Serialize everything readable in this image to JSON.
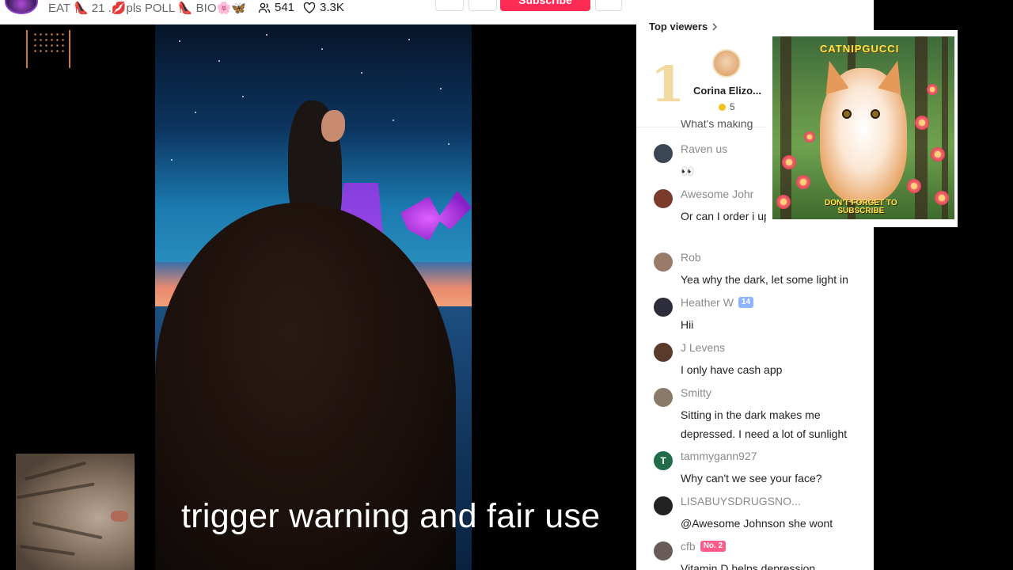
{
  "header": {
    "title": "EAT 👠 21 .💋pls POLL 👠 BIO🌸🦋",
    "viewers": "541",
    "likes": "3.3K",
    "subscribe_label": "Subscribe"
  },
  "caption": "trigger warning and fair use",
  "top_viewers": {
    "label": "Top viewers",
    "rank": "1",
    "name": "Corina Elizo...",
    "coins": "5",
    "partial_text": "What's making"
  },
  "comments": [
    {
      "name": "Raven us",
      "text": "👀",
      "badge": "",
      "avatar_color": "#3b4654"
    },
    {
      "name": "Awesome Johr",
      "text": "Or can I order i up",
      "badge": "",
      "avatar_color": "#7a3b2a"
    },
    {
      "name": "Rob",
      "text": "Yea why the dark, let some light in",
      "badge": "",
      "avatar_color": "#9a7a68"
    },
    {
      "name": "Heather W",
      "text": "Hii",
      "badge": "14",
      "avatar_color": "#2c2c3a"
    },
    {
      "name": "J Levens",
      "text": "I only have cash app",
      "badge": "",
      "avatar_color": "#5a3a2a"
    },
    {
      "name": "Smitty",
      "text": "Sitting in the dark makes me depressed. I need a lot of sunlight",
      "badge": "",
      "avatar_color": "#8a7a6a"
    },
    {
      "name": "tammygann927",
      "text": "Why can't we see your face?",
      "badge": "",
      "avatar_color": "#1f6b4a",
      "initial": "T"
    },
    {
      "name": "LISABUYSDRUGSNO...",
      "text": "@Awesome Johnson she wont",
      "badge": "",
      "avatar_color": "#222222"
    },
    {
      "name": "cfb",
      "text": "Vitamin D helps depression",
      "badge": "No. 2",
      "avatar_color": "#6a5a5a"
    }
  ],
  "promo": {
    "title": "CATNIPGUCCI",
    "subtitle_line1": "DON'T FORGET TO",
    "subtitle_line2": "SUBSCRIBE"
  },
  "colors": {
    "subscribe": "#fe2c55",
    "badge_blue": "#8eb3ff",
    "badge_pink": "#ff5b8a"
  }
}
